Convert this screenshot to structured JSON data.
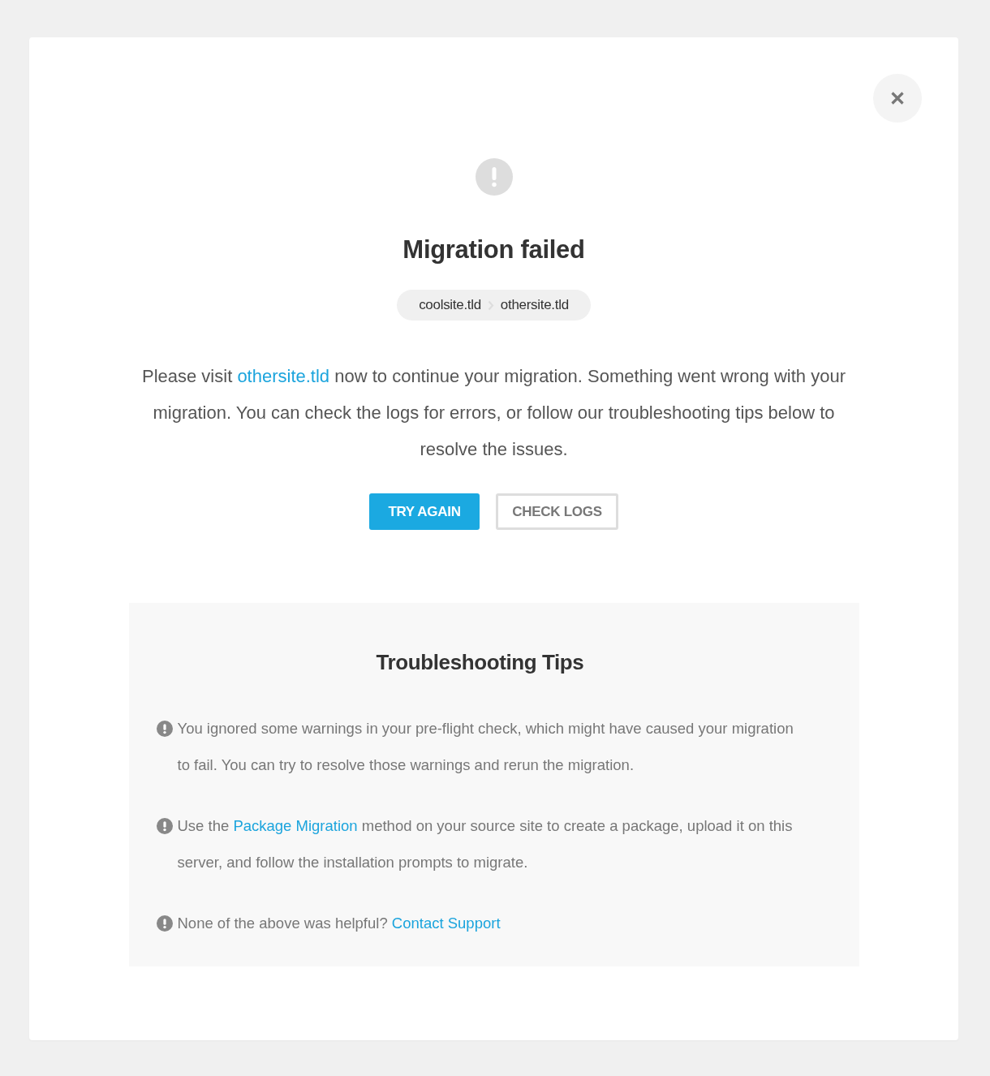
{
  "dialog": {
    "title": "Migration failed",
    "route": {
      "from": "coolsite.tld",
      "to": "othersite.tld"
    },
    "message": [
      {
        "kind": "text",
        "text": "Please visit "
      },
      {
        "kind": "link",
        "text": "othersite.tld"
      },
      {
        "kind": "text",
        "text": " now to continue your migration. Something went wrong with your migration. You can check the logs for errors, or follow our troubleshooting tips below to resolve the issues."
      }
    ],
    "buttons": [
      {
        "label": "TRY AGAIN",
        "kind": "primary"
      },
      {
        "label": "CHECK LOGS",
        "kind": "secondary"
      }
    ]
  },
  "troubleshooting": {
    "title": "Troubleshooting Tips",
    "tips": [
      {
        "segments": [
          {
            "kind": "text",
            "text": "You ignored some warnings in your pre-flight check, which might have caused your migration to fail. You can try to resolve those warnings and rerun the migration."
          }
        ]
      },
      {
        "segments": [
          {
            "kind": "text",
            "text": "Use the "
          },
          {
            "kind": "link",
            "text": "Package Migration"
          },
          {
            "kind": "text",
            "text": " method on your source site to create a package, upload it on this server, and follow the installation prompts to migrate."
          }
        ]
      },
      {
        "segments": [
          {
            "kind": "text",
            "text": "None of the above was helpful? "
          },
          {
            "kind": "link",
            "text": "Contact Support"
          }
        ]
      }
    ]
  }
}
